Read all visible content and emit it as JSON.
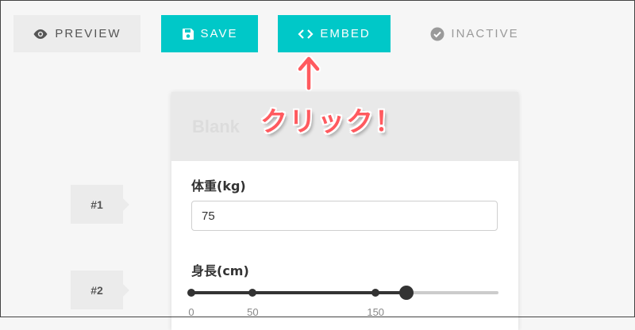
{
  "toolbar": {
    "preview_label": "PREVIEW",
    "save_label": "SAVE",
    "embed_label": "EMBED",
    "inactive_label": "INACTIVE"
  },
  "annotation": {
    "callout": "クリック！"
  },
  "form": {
    "header_title": "Blank",
    "weight": {
      "label": "体重(kg)",
      "value": "75"
    },
    "height": {
      "label": "身長(cm)",
      "slider_min": 0,
      "slider_max": 250,
      "slider_value": 175,
      "tick_values": [
        0,
        50,
        150
      ],
      "tick_labels": [
        "0",
        "50",
        "150"
      ]
    }
  },
  "steps": [
    "#1",
    "#2"
  ],
  "colors": {
    "accent": "#00c8c8",
    "callout": "#ff5a5f",
    "slider": "#333333"
  },
  "icons": {
    "preview": "eye-icon",
    "save": "floppy-disk-icon",
    "embed": "code-brackets-icon",
    "inactive": "check-circle-icon",
    "arrow": "up-arrow-icon"
  }
}
